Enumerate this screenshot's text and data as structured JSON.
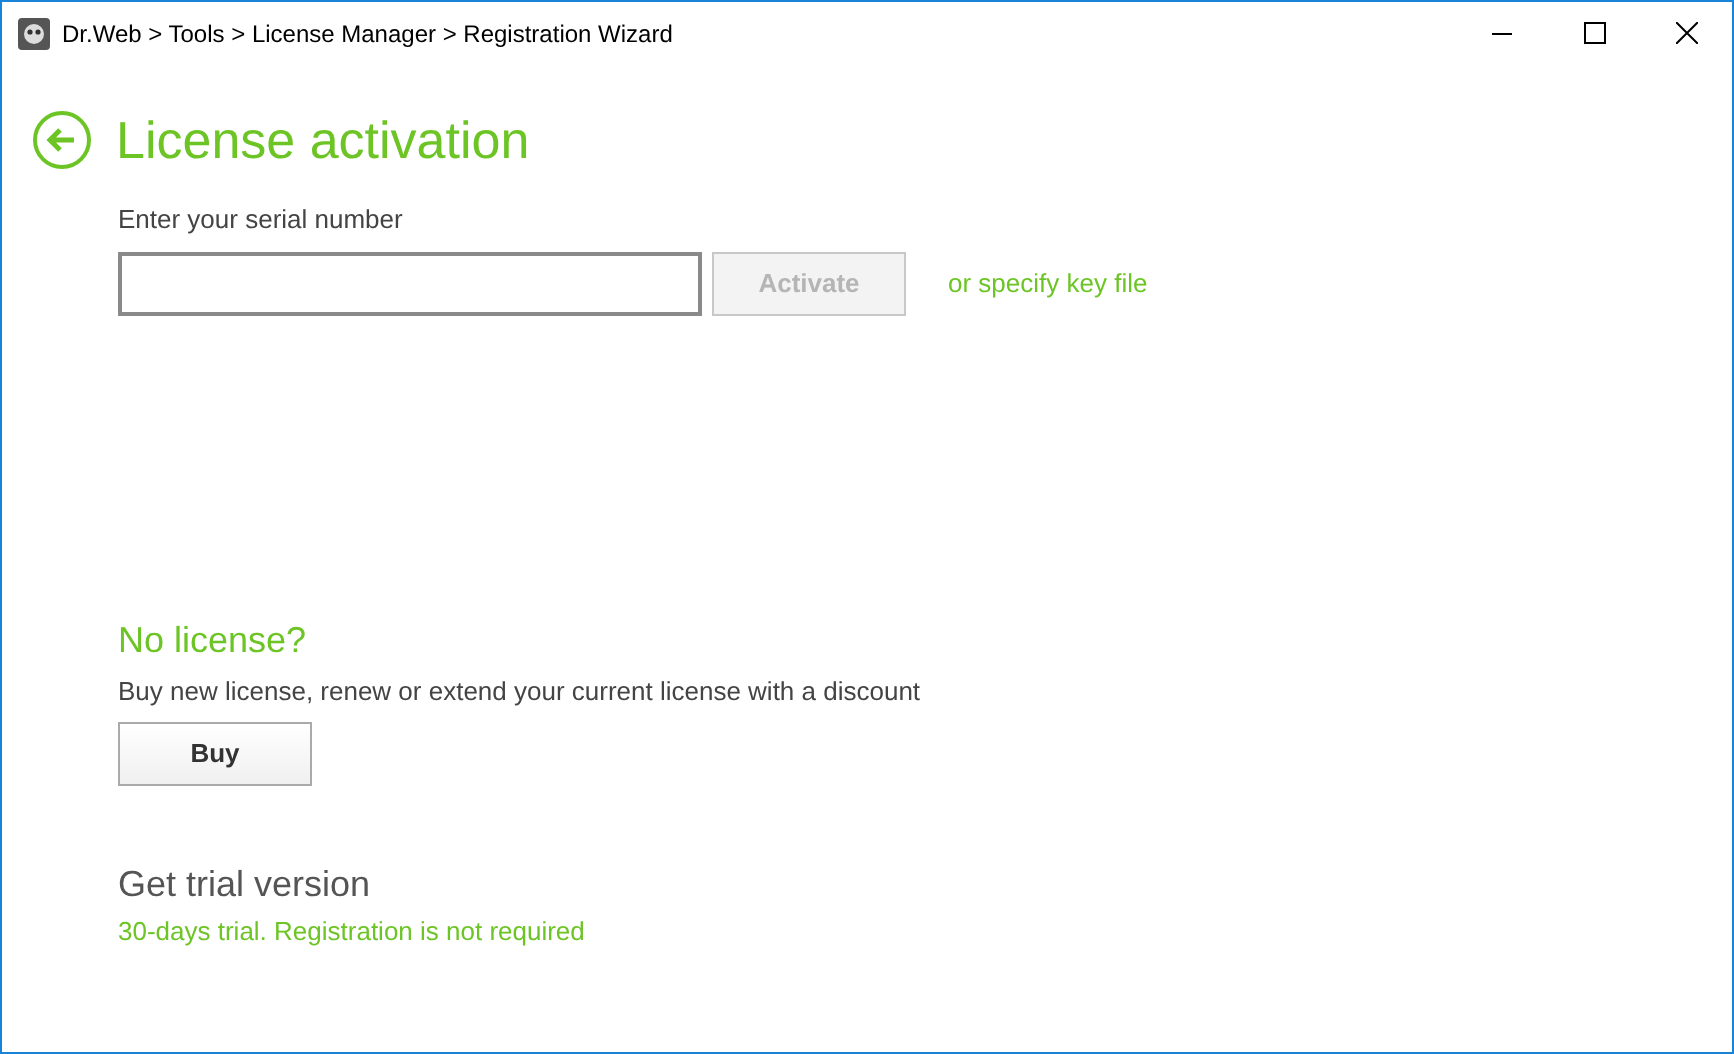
{
  "window": {
    "title": "Dr.Web > Tools > License Manager > Registration Wizard"
  },
  "page": {
    "title": "License activation"
  },
  "serial": {
    "label": "Enter your serial number",
    "activate": {
      "label": "Activate",
      "disabled": true
    },
    "key_file_link": "or specify key file"
  },
  "no_license": {
    "heading": "No license?",
    "text": "Buy new license, renew or extend your current license with a discount",
    "button": "Buy"
  },
  "trial": {
    "heading": "Get trial version",
    "link": "30-days trial. Registration is not required"
  }
}
